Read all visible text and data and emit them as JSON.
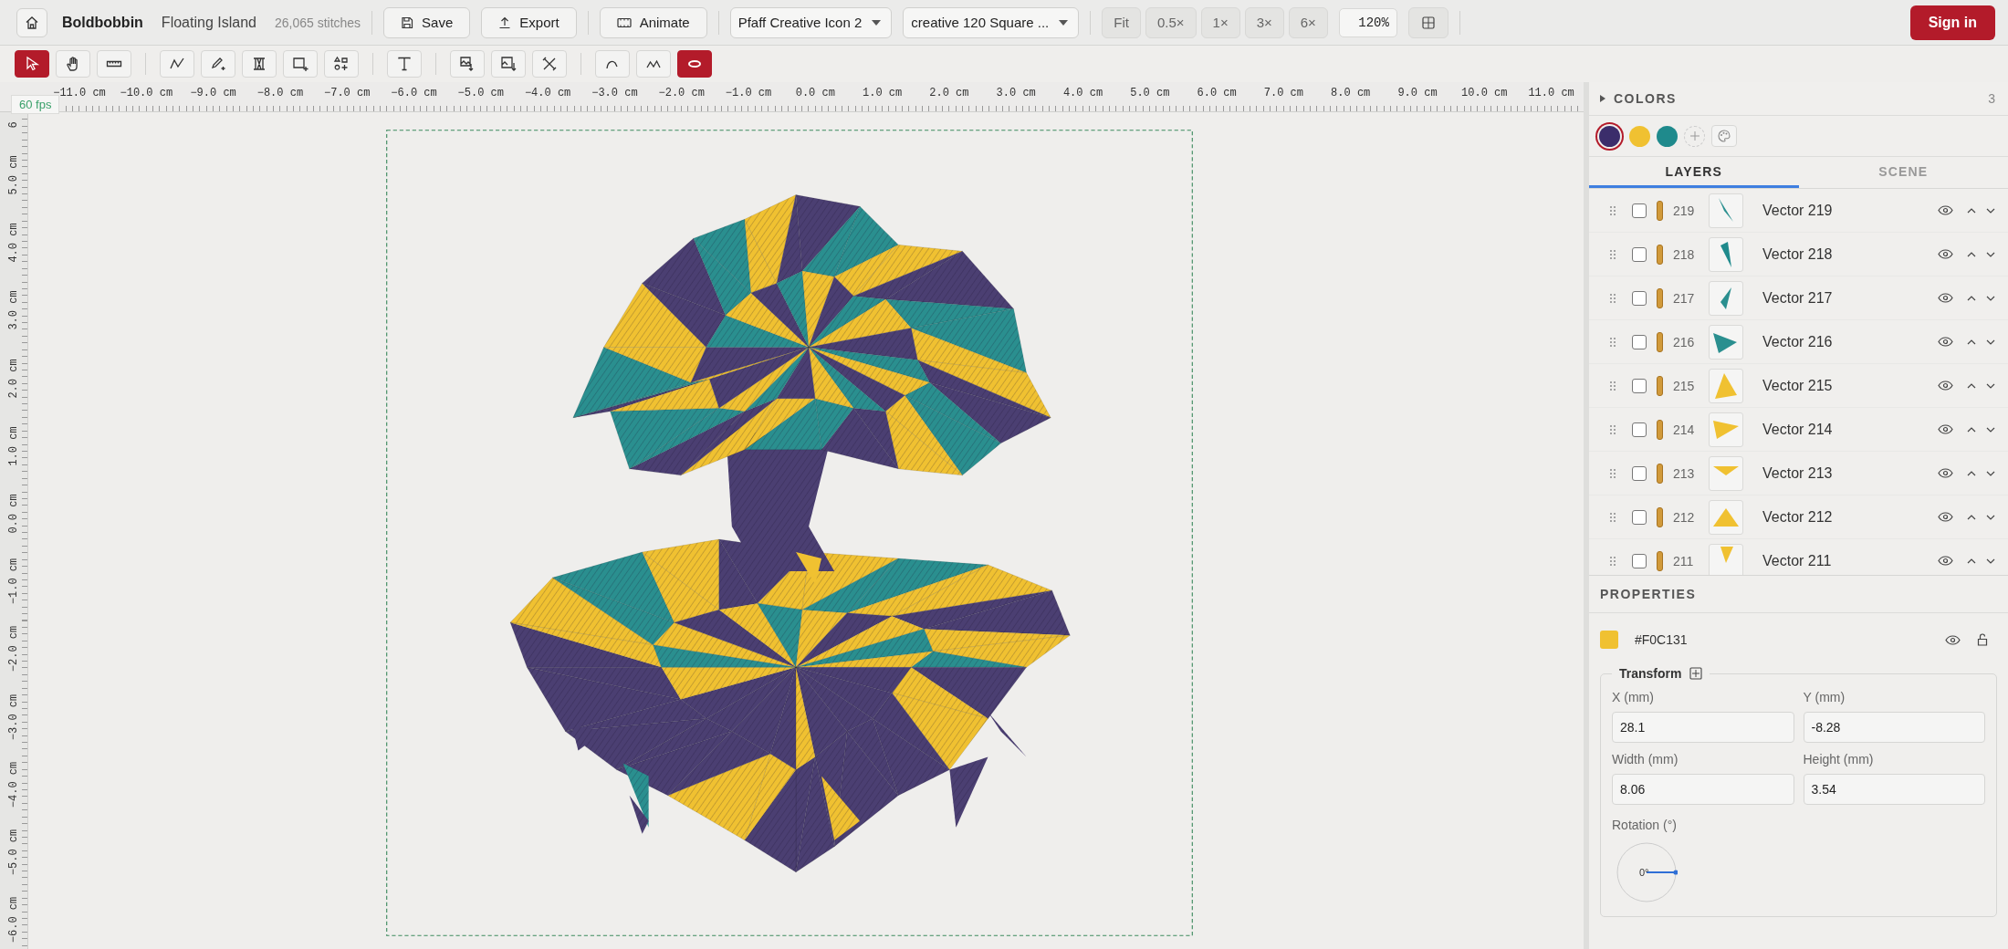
{
  "topbar": {
    "app_name": "Boldbobbin",
    "project": "Floating Island",
    "stitches": "26,065 stitches",
    "actions": [
      {
        "kind": "save",
        "label": "Save"
      },
      {
        "kind": "export",
        "label": "Export"
      }
    ],
    "animate": "Animate",
    "machine": "Pfaff Creative Icon 2",
    "hoop": "creative 120 Square ...",
    "zoom_presets": [
      "Fit",
      "0.5×",
      "1×",
      "3×",
      "6×"
    ],
    "zoom_value": "120%",
    "sign_in": "Sign in"
  },
  "tools": [
    [
      {
        "kind": "select",
        "selected": true
      },
      {
        "kind": "hand",
        "selected": false
      },
      {
        "kind": "measure",
        "selected": false
      }
    ],
    [
      {
        "kind": "polyline",
        "selected": false
      },
      {
        "kind": "pen",
        "selected": false
      },
      {
        "kind": "column",
        "selected": false
      },
      {
        "kind": "rect",
        "selected": false
      },
      {
        "kind": "shapes",
        "selected": false
      }
    ],
    [
      {
        "kind": "text",
        "selected": false
      }
    ],
    [
      {
        "kind": "image-in",
        "selected": false
      },
      {
        "kind": "image-out",
        "selected": false
      },
      {
        "kind": "cross",
        "selected": false
      }
    ],
    [
      {
        "kind": "curve",
        "selected": false
      },
      {
        "kind": "zigzag",
        "selected": false
      },
      {
        "kind": "oval",
        "selected": true
      }
    ]
  ],
  "fps": "60 fps",
  "ruler": {
    "horizontal": [
      "−11.0 cm",
      "−10.0 cm",
      "−9.0 cm",
      "−8.0 cm",
      "−7.0 cm",
      "−6.0 cm",
      "−5.0 cm",
      "−4.0 cm",
      "−3.0 cm",
      "−2.0 cm",
      "−1.0 cm",
      "0.0 cm",
      "1.0 cm",
      "2.0 cm",
      "3.0 cm",
      "4.0 cm",
      "5.0 cm",
      "6.0 cm",
      "7.0 cm",
      "8.0 cm",
      "9.0 cm",
      "10.0 cm",
      "11.0 cm"
    ],
    "vertical": [
      "6",
      "5.0 cm",
      "4.0 cm",
      "3.0 cm",
      "2.0 cm",
      "1.0 cm",
      "0.0 cm",
      "−1.0 cm",
      "−2.0 cm",
      "−3.0 cm",
      "−4.0 cm",
      "−5.0 cm",
      "−6.0 cm"
    ]
  },
  "colors": {
    "title": "COLORS",
    "count": "3",
    "swatches": [
      {
        "color": "#3b2d6b",
        "selected": true
      },
      {
        "color": "#f0c131",
        "selected": false
      },
      {
        "color": "#1f8a8c",
        "selected": false
      }
    ]
  },
  "tabs": [
    {
      "label": "LAYERS",
      "selected": true
    },
    {
      "label": "SCENE",
      "selected": false
    }
  ],
  "layers": [
    {
      "number": "219",
      "name": "Vector 219",
      "color": "#2a8f8f",
      "checked": false
    },
    {
      "number": "218",
      "name": "Vector 218",
      "color": "#1f8a8c",
      "checked": false
    },
    {
      "number": "217",
      "name": "Vector 217",
      "color": "#2a8f8f",
      "checked": false
    },
    {
      "number": "216",
      "name": "Vector 216",
      "color": "#2a8f8f",
      "checked": false
    },
    {
      "number": "215",
      "name": "Vector 215",
      "color": "#f0c131",
      "checked": false
    },
    {
      "number": "214",
      "name": "Vector 214",
      "color": "#f0c131",
      "checked": false
    },
    {
      "number": "213",
      "name": "Vector 213",
      "color": "#f0c131",
      "checked": false
    },
    {
      "number": "212",
      "name": "Vector 212",
      "color": "#f0c131",
      "checked": false
    },
    {
      "number": "211",
      "name": "Vector 211",
      "color": "#f0c131",
      "checked": false
    }
  ],
  "properties": {
    "title": "PROPERTIES",
    "fill_label": "#F0C131",
    "transform": "Transform",
    "fields": [
      {
        "label": "X (mm)",
        "value": "28.1"
      },
      {
        "label": "Y (mm)",
        "value": "-8.28"
      },
      {
        "label": "Width (mm)",
        "value": "8.06"
      },
      {
        "label": "Height (mm)",
        "value": "3.54"
      }
    ],
    "rotation_label": "Rotation (°)",
    "rotation_value": "0°"
  }
}
